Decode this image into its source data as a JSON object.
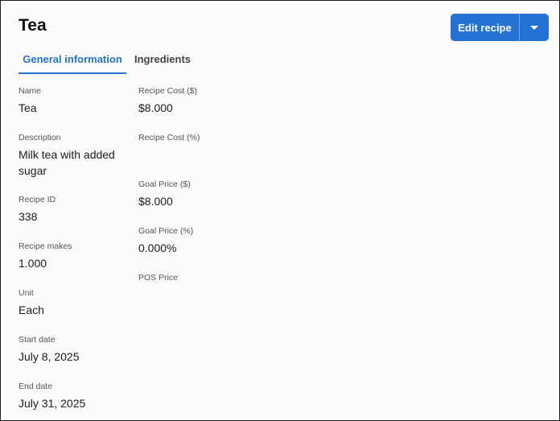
{
  "header": {
    "title": "Tea",
    "edit_label": "Edit recipe",
    "dropdown_icon": "chevron-down-icon"
  },
  "tabs": [
    {
      "label": "General information",
      "active": true
    },
    {
      "label": "Ingredients",
      "active": false
    }
  ],
  "left_fields": [
    {
      "label": "Name",
      "value": "Tea"
    },
    {
      "label": "Description",
      "value": "Milk tea with added sugar"
    },
    {
      "label": "Recipe ID",
      "value": "338"
    },
    {
      "label": "Recipe makes",
      "value": "1.000"
    },
    {
      "label": "Unit",
      "value": "Each"
    },
    {
      "label": "Start date",
      "value": "July 8, 2025"
    },
    {
      "label": "End date",
      "value": "July 31, 2025"
    }
  ],
  "right_fields": [
    {
      "label": "Recipe Cost ($)",
      "value": "$8.000"
    },
    {
      "label": "Recipe Cost (%)",
      "value": ""
    },
    {
      "label": "Goal Price ($)",
      "value": "$8.000"
    },
    {
      "label": "Goal Price (%)",
      "value": "0.000%"
    },
    {
      "label": "POS Price",
      "value": ""
    }
  ],
  "colors": {
    "accent": "#2473d4",
    "text": "#1c1c1c",
    "label": "#555555"
  }
}
